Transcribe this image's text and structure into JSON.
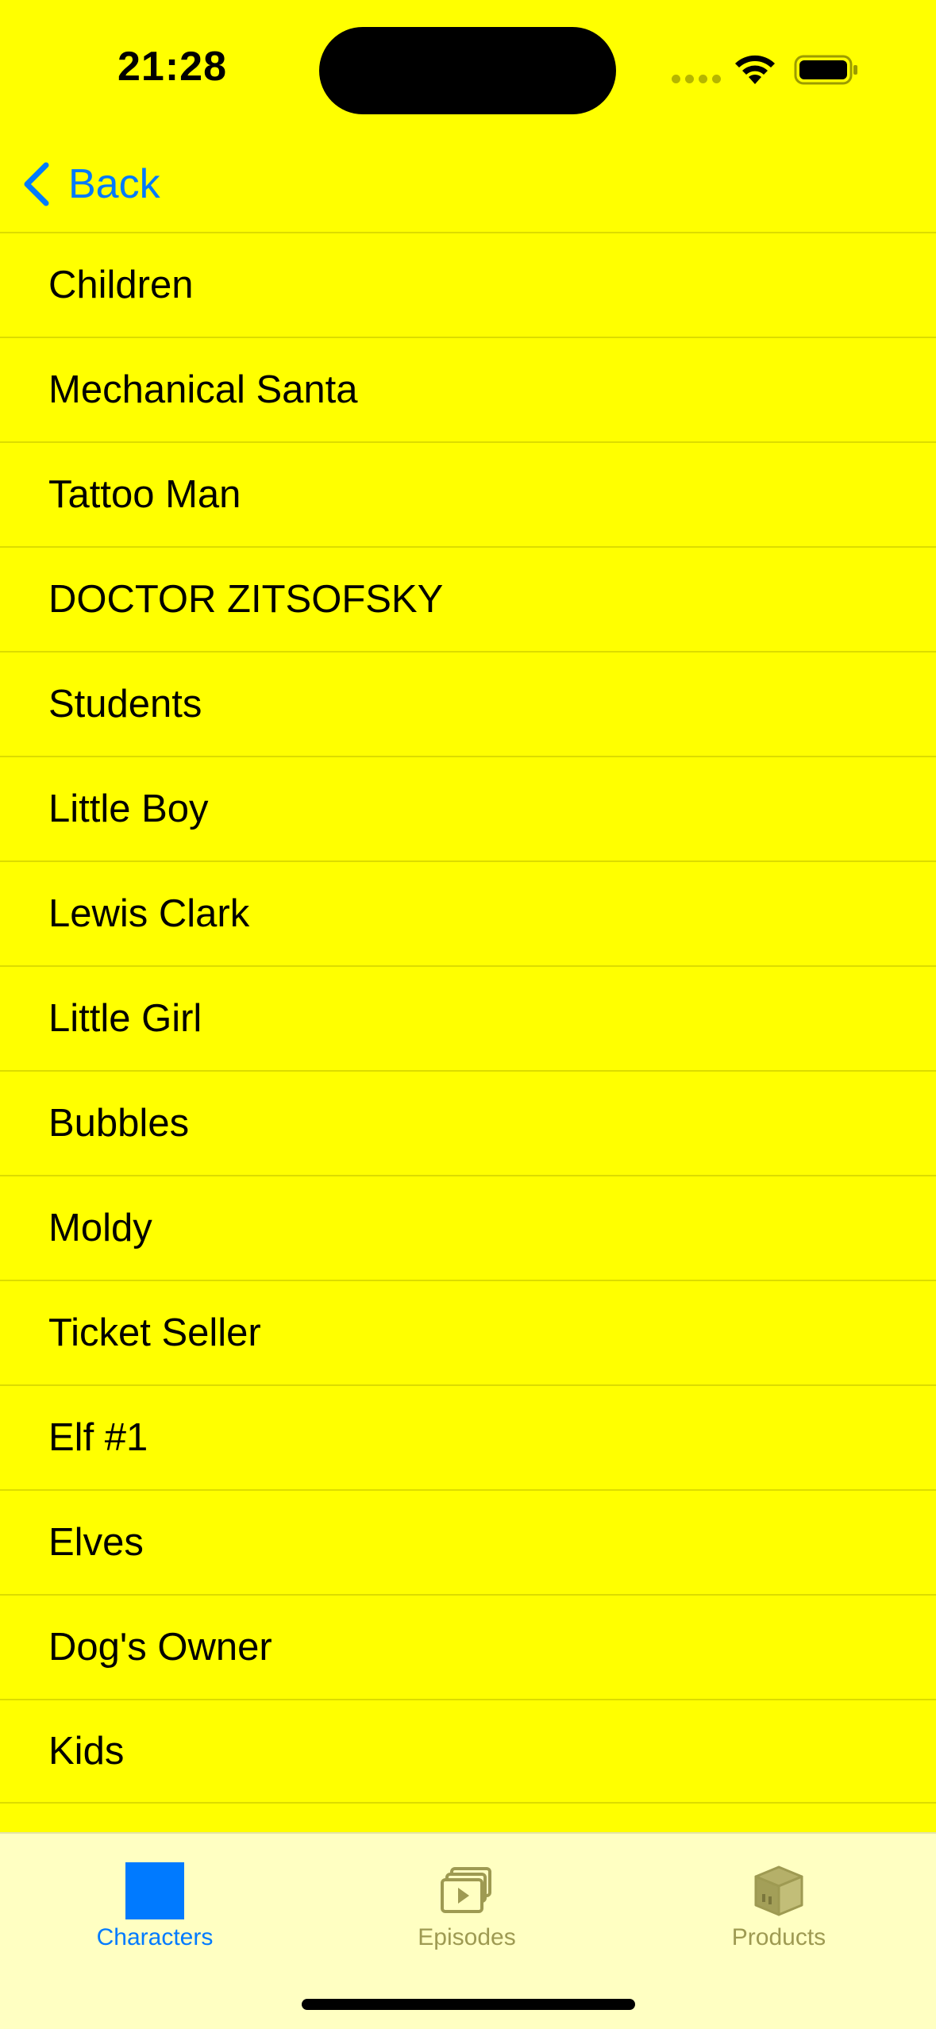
{
  "status_bar": {
    "time": "21:28"
  },
  "nav": {
    "back_label": "Back"
  },
  "list": {
    "items": [
      "Children",
      "Mechanical Santa",
      "Tattoo Man",
      "DOCTOR ZITSOFSKY",
      "Students",
      "Little Boy",
      "Lewis Clark",
      "Little Girl",
      "Bubbles",
      "Moldy",
      "Ticket Seller",
      "Elf #1",
      "Elves",
      "Dog's Owner",
      "Kids"
    ]
  },
  "tab_bar": {
    "tabs": [
      {
        "label": "Characters",
        "icon": "blue-square-icon",
        "active": true
      },
      {
        "label": "Episodes",
        "icon": "video-stack-icon",
        "active": false
      },
      {
        "label": "Products",
        "icon": "box-icon",
        "active": false
      }
    ]
  },
  "colors": {
    "background": "#FFFF00",
    "tab_bar_background": "#FFFFC2",
    "accent": "#007AFF",
    "inactive_tab": "#9E9A52"
  }
}
